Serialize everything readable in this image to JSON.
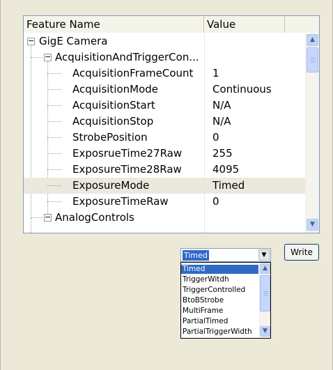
{
  "grid": {
    "headers": {
      "name": "Feature Name",
      "value": "Value"
    },
    "rows": [
      {
        "name": "GigE Camera",
        "value": ""
      },
      {
        "name": "AcquisitionAndTriggerCon...",
        "value": ""
      },
      {
        "name": "AcquisitionFrameCount",
        "value": "1"
      },
      {
        "name": "AcquisitionMode",
        "value": "Continuous"
      },
      {
        "name": "AcquisitionStart",
        "value": "N/A"
      },
      {
        "name": "AcquisitionStop",
        "value": "N/A"
      },
      {
        "name": "StrobePosition",
        "value": "0"
      },
      {
        "name": "ExposrueTime27Raw",
        "value": "255"
      },
      {
        "name": "ExposureTime28Raw",
        "value": "4095"
      },
      {
        "name": "ExposureMode",
        "value": "Timed"
      },
      {
        "name": "ExposureTimeRaw",
        "value": "0"
      },
      {
        "name": "AnalogControls",
        "value": ""
      }
    ],
    "selected_row": "ExposureMode",
    "expander_collapse_glyph": "−"
  },
  "combo": {
    "value": "Timed",
    "options": [
      "Timed",
      "TriggerWitdh",
      "TriggerControlled",
      "BtoBStrobe",
      "MultiFrame",
      "PartialTimed",
      "PartialTriggerWidth"
    ]
  },
  "write_button": {
    "label": "Write"
  },
  "icons": {
    "scroll_up": "▲",
    "scroll_down": "▼",
    "dropdown_arrow": "▼"
  },
  "colors": {
    "selection": "#316ac5",
    "selected_row": "#ebe8de",
    "scrollbar": "#c1d3fb"
  }
}
